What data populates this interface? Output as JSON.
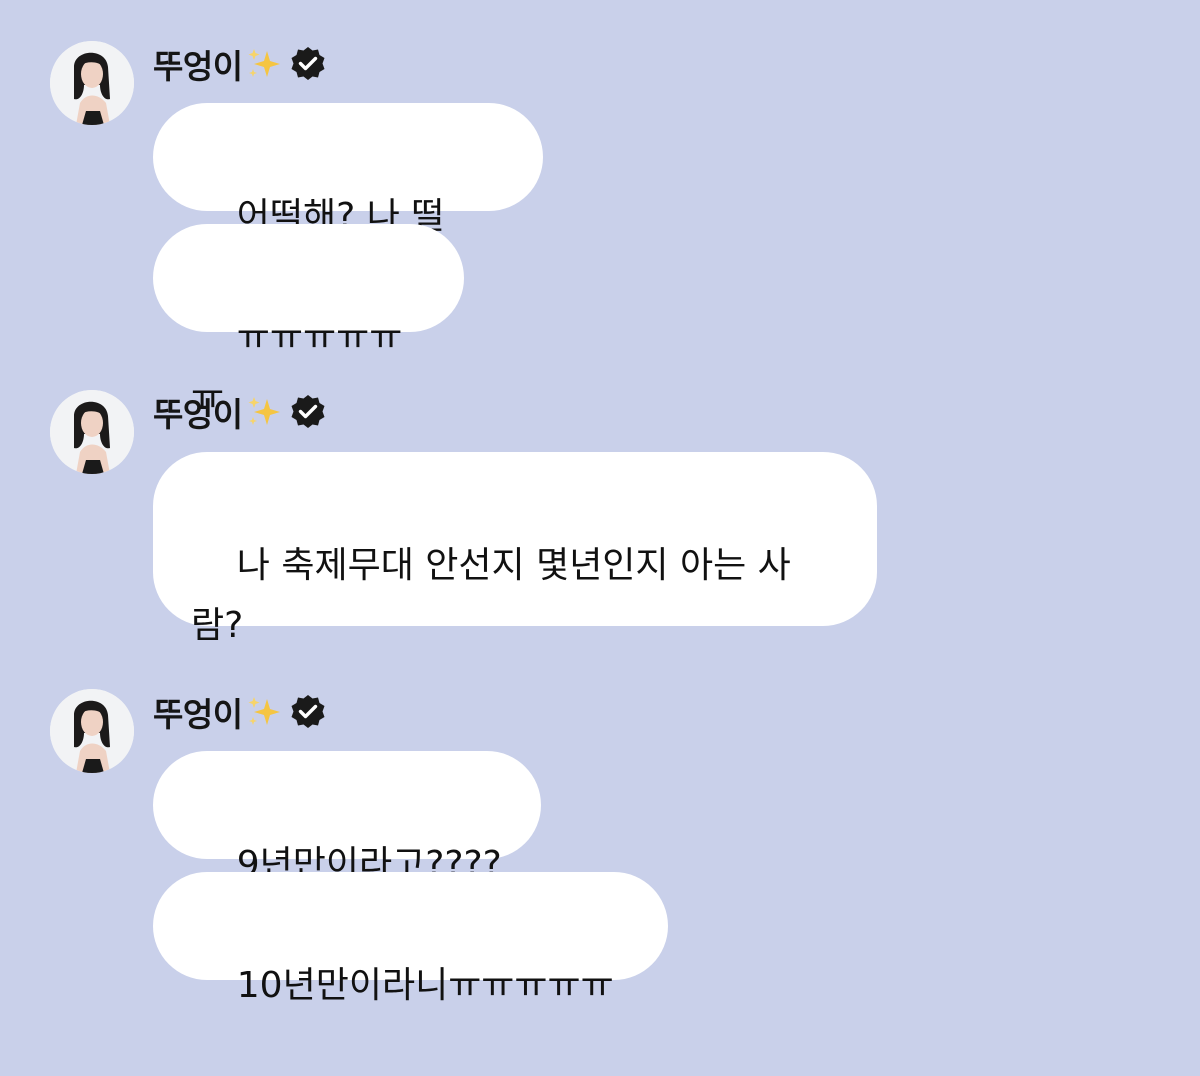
{
  "background_color": "#c9d0ea",
  "groups": [
    {
      "sender": {
        "name": "뚜엉이",
        "emoji": "sparkles-icon",
        "verified": "verified-badge-icon"
      },
      "messages": [
        {
          "text": "어떡해? 나 떨려..."
        },
        {
          "text": "ㅠㅠㅠㅠㅠㅠ"
        }
      ]
    },
    {
      "sender": {
        "name": "뚜엉이",
        "emoji": "sparkles-icon",
        "verified": "verified-badge-icon"
      },
      "messages": [
        {
          "text": "나 축제무대 안선지 몇년인지 아는 사람?"
        }
      ]
    },
    {
      "sender": {
        "name": "뚜엉이",
        "emoji": "sparkles-icon",
        "verified": "verified-badge-icon"
      },
      "messages": [
        {
          "text": "9년만이라고????"
        },
        {
          "text": "10년만이라니ㅠㅠㅠㅠㅠ"
        }
      ]
    }
  ]
}
